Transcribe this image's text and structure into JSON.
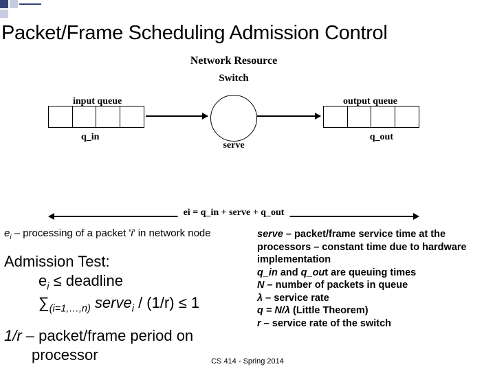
{
  "title": "Packet/Frame Scheduling Admission Control",
  "diagram": {
    "network_resource": "Network Resource",
    "switch": "Switch",
    "input_queue": "input queue",
    "output_queue": "output queue",
    "q_in": "q_in",
    "q_out": "q_out",
    "serve": "serve",
    "ei_equation": "ei = q_in + serve + q_out"
  },
  "left": {
    "ei_prefix": "e",
    "ei_sub": "i",
    "ei_rest": " – processing  of a packet '",
    "ei_i": "i",
    "ei_end": "' in network node",
    "adm_title": "Admission Test:",
    "adm_line1_a": "e",
    "adm_line1_sub": "i",
    "adm_line1_b": " ≤ deadline",
    "adm_line2_a": "∑",
    "adm_line2_sub": "(i=1,…,n)",
    "adm_line2_b": " serve",
    "adm_line2_subi": "i",
    "adm_line2_c": " / (1/r) ≤ 1",
    "period1": "1/r – packet/frame period on",
    "period2": "processor"
  },
  "right": {
    "l1a": "serve",
    "l1b": " – packet/frame  service time at the processors – constant time due to hardware implementation",
    "l2a": "q_in",
    "l2mid": " and ",
    "l2b": "q_ou",
    "l2c": "t are queuing times",
    "l3a": "N",
    "l3b": " – number of packets in queue",
    "l4a": "λ",
    "l4b": " – service rate",
    "l5a": "q = N/λ ",
    "l5b": " (Little Theorem)",
    "l6a": "r",
    "l6b": " – service rate of the switch"
  },
  "footer": "CS 414 - Spring 2014"
}
